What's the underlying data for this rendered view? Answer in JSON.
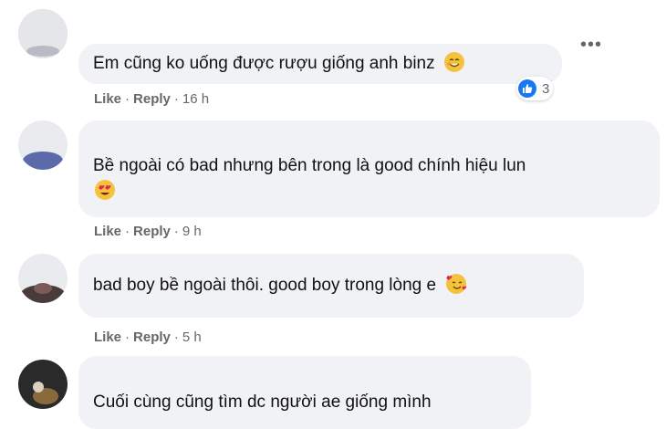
{
  "comments": [
    {
      "text": "Em cũng ko uống được rượu giống anh binz",
      "emoji": "smiling-face-icon",
      "like": "Like",
      "reply": "Reply",
      "time": "16 h",
      "reactions": {
        "icon": "like-icon",
        "count": "3"
      }
    },
    {
      "text": "Bề ngoài có bad nhưng bên trong là good chính hiệu lun",
      "emoji": "heart-eyes-face-icon",
      "like": "Like",
      "reply": "Reply",
      "time": "9 h"
    },
    {
      "text": "bad boy bề ngoài thôi. good boy trong lòng e",
      "emoji": "smiling-face-with-hearts-icon",
      "like": "Like",
      "reply": "Reply",
      "time": "5 h"
    },
    {
      "text": "Cuối cùng cũng tìm dc người ae giống mình"
    }
  ],
  "more_menu": "•••",
  "separator": "·",
  "colors": {
    "bubble": "#f0f2f5",
    "meta_text": "#65676b",
    "like_blue": "#1877f2",
    "emoji_yellow": "#f5c33b"
  }
}
